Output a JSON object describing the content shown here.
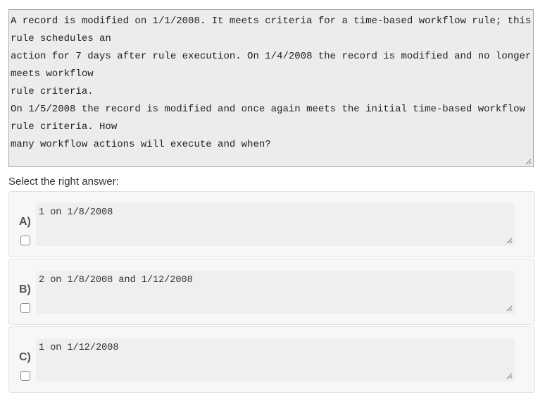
{
  "question": {
    "lines": [
      "A record is modified on 1/1/2008. It meets criteria for a time-based workflow rule; this",
      "rule schedules an",
      "action for 7 days after rule execution. On 1/4/2008 the record is modified and no longer",
      "meets workflow",
      "rule criteria.",
      "On 1/5/2008 the record is modified and once again meets the initial time-based workflow",
      "rule criteria. How",
      "many workflow actions will execute and when?"
    ]
  },
  "prompt": "Select the right answer:",
  "options": [
    {
      "letter": "A)",
      "text": "1 on 1/8/2008",
      "checked": false
    },
    {
      "letter": "B)",
      "text": "2 on 1/8/2008 and 1/12/2008",
      "checked": false
    },
    {
      "letter": "C)",
      "text": "1 on 1/12/2008",
      "checked": false
    }
  ]
}
